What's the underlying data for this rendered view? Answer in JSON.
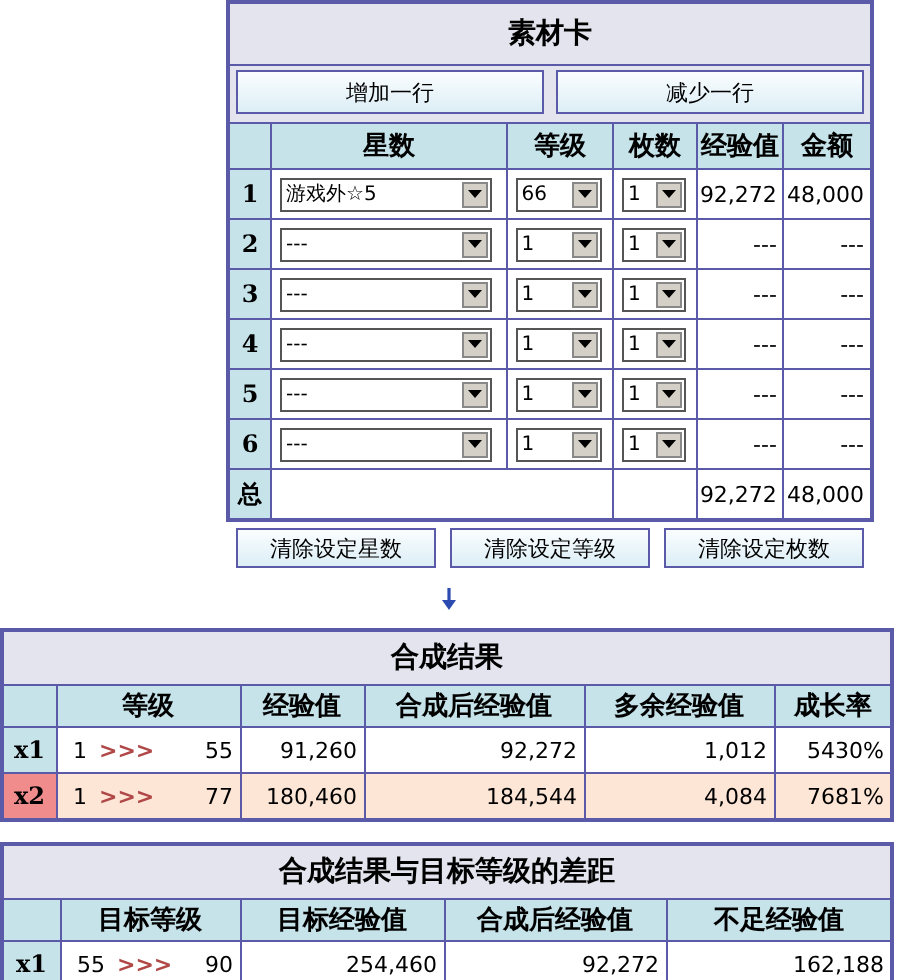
{
  "card": {
    "title": "素材卡",
    "buttons": [
      "增加一行",
      "减少一行"
    ],
    "columns": [
      "星数",
      "等级",
      "枚数",
      "经验值",
      "金额"
    ],
    "rows": [
      {
        "index": "1",
        "star": "游戏外☆5",
        "level": "66",
        "count": "1",
        "exp": "92,272",
        "price": "48,000"
      },
      {
        "index": "2",
        "star": "---",
        "level": "1",
        "count": "1",
        "exp": "---",
        "price": "---"
      },
      {
        "index": "3",
        "star": "---",
        "level": "1",
        "count": "1",
        "exp": "---",
        "price": "---"
      },
      {
        "index": "4",
        "star": "---",
        "level": "1",
        "count": "1",
        "exp": "---",
        "price": "---"
      },
      {
        "index": "5",
        "star": "---",
        "level": "1",
        "count": "1",
        "exp": "---",
        "price": "---"
      },
      {
        "index": "6",
        "star": "---",
        "level": "1",
        "count": "1",
        "exp": "---",
        "price": "---"
      }
    ],
    "total": {
      "label": "总",
      "exp": "92,272",
      "price": "48,000"
    },
    "clear_buttons": [
      "清除设定星数",
      "清除设定等级",
      "清除设定枚数"
    ]
  },
  "results": {
    "title": "合成结果",
    "columns": [
      "等级",
      "经验值",
      "合成后经验值",
      "多余经验值",
      "成长率"
    ],
    "rows": [
      {
        "label": "x1",
        "from": "1",
        "arrow": ">>>",
        "to": "55",
        "exp": "91,260",
        "after": "92,272",
        "surplus": "1,012",
        "rate": "5430%",
        "selected": false
      },
      {
        "label": "x2",
        "from": "1",
        "arrow": ">>>",
        "to": "77",
        "exp": "180,460",
        "after": "184,544",
        "surplus": "4,084",
        "rate": "7681%",
        "selected": true
      }
    ]
  },
  "gap": {
    "title": "合成结果与目标等级的差距",
    "columns": [
      "目标等级",
      "目标经验值",
      "合成后经验值",
      "不足经验值"
    ],
    "rows": [
      {
        "label": "x1",
        "from": "55",
        "arrow": ">>>",
        "to": "90",
        "target_exp": "254,460",
        "after": "92,272",
        "shortfall": "162,188"
      }
    ]
  }
}
